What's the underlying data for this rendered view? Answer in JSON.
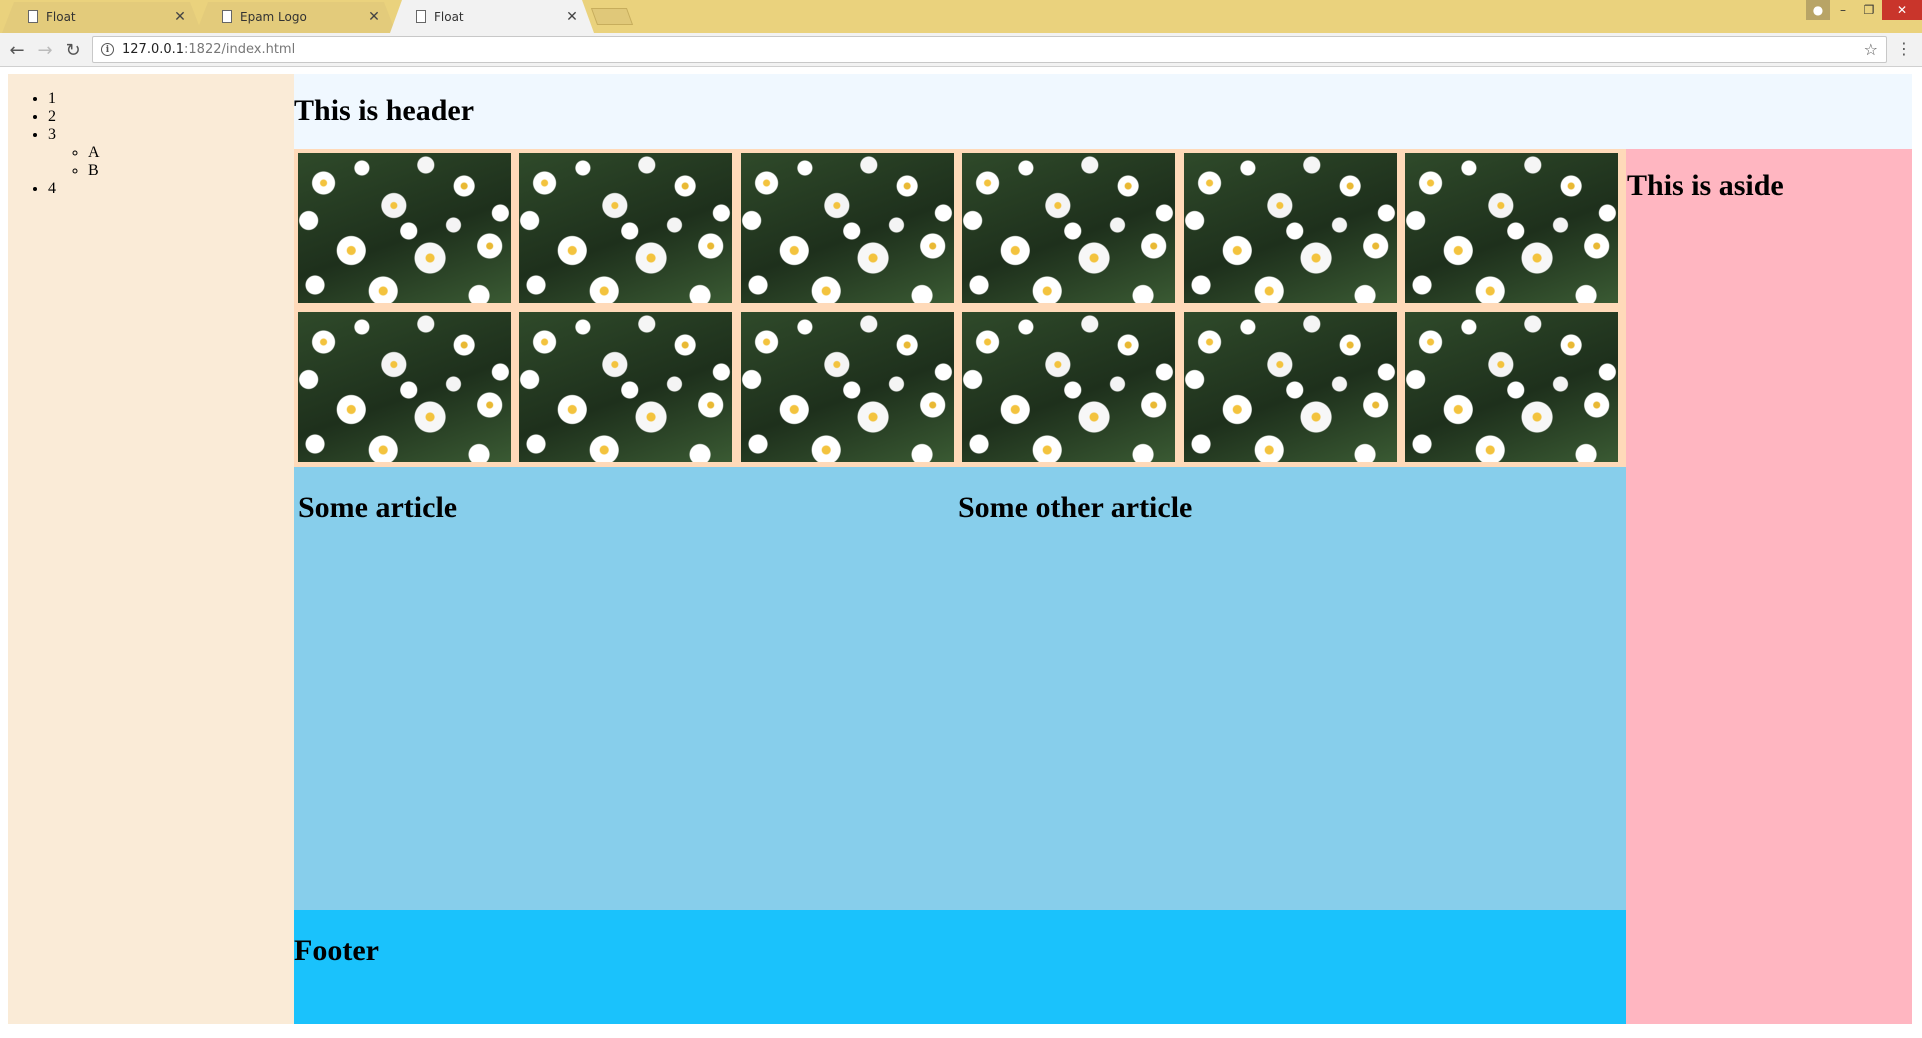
{
  "browser": {
    "tabs": [
      {
        "title": "Float",
        "active": false
      },
      {
        "title": "Epam Logo",
        "active": false
      },
      {
        "title": "Float",
        "active": true
      }
    ],
    "url_host": "127.0.0.1",
    "url_rest": ":1822/index.html",
    "icons": {
      "back": "back-arrow-icon",
      "forward": "forward-arrow-icon",
      "reload": "reload-icon",
      "info": "info-icon",
      "star": "star-icon",
      "menu": "menu-dots-icon"
    }
  },
  "nav": {
    "items": [
      "1",
      "2",
      "3",
      "4"
    ],
    "subitems": [
      "A",
      "B"
    ]
  },
  "header": {
    "title": "This is header"
  },
  "gallery": {
    "image_count": 12,
    "image_subject": "daisies"
  },
  "articles": {
    "first_title": "Some article",
    "second_title": "Some other article"
  },
  "aside": {
    "title": "This is aside"
  },
  "footer": {
    "title": "Footer"
  },
  "colors": {
    "tabstrip": "#ead27d",
    "nav_bg": "#faebd7",
    "header_bg": "#f0f8ff",
    "gallery_bg": "#ffdab9",
    "articles_bg": "#87ceeb",
    "aside_bg": "#ffb6c1",
    "footer_bg": "#1ac2fc"
  }
}
